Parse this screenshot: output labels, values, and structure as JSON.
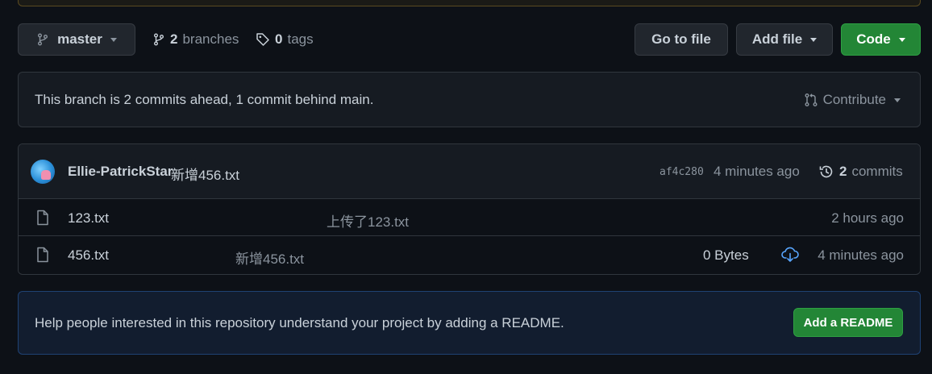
{
  "toolbar": {
    "branch_label": "master",
    "branches_count": "2",
    "branches_label": "branches",
    "tags_count": "0",
    "tags_label": "tags",
    "go_to_file_label": "Go to file",
    "add_file_label": "Add file",
    "code_label": "Code"
  },
  "branch_status": {
    "text": "This branch is 2 commits ahead, 1 commit behind main.",
    "contribute_label": "Contribute"
  },
  "latest_commit": {
    "author": "Ellie-PatrickStar",
    "message": "新增456.txt",
    "sha": "af4c280",
    "time": "4 minutes ago",
    "commits_count": "2",
    "commits_label": "commits"
  },
  "files": [
    {
      "name": "123.txt",
      "commit_message": "上传了123.txt",
      "size": "",
      "time": "2 hours ago"
    },
    {
      "name": "456.txt",
      "commit_message": "新增456.txt",
      "size": "0 Bytes",
      "time": "4 minutes ago"
    }
  ],
  "readme_prompt": {
    "text": "Help people interested in this repository understand your project by adding a README.",
    "button_label": "Add a README"
  },
  "colors": {
    "background": "#0d1117",
    "accent_green": "#238636",
    "download_icon": "#58a6ff"
  },
  "icons": [
    "branch-icon",
    "tag-icon",
    "pull-request-icon",
    "history-icon",
    "file-icon",
    "cloud-download-icon",
    "caret-down-icon"
  ]
}
